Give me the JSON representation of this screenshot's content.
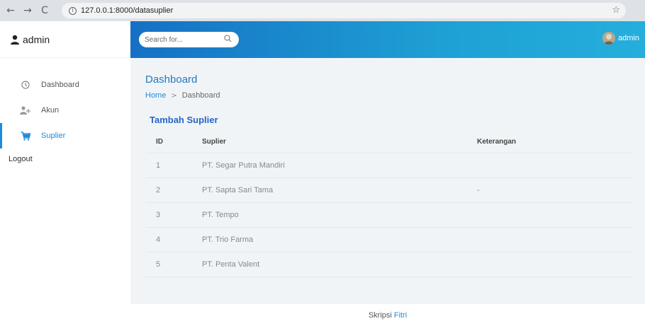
{
  "browser": {
    "url": "127.0.0.1:8000/datasuplier",
    "back_glyph": "←",
    "forward_glyph": "→",
    "reload_glyph": "C",
    "star_glyph": "☆",
    "info_glyph": "i"
  },
  "sidebar": {
    "brand": "admin",
    "items": [
      {
        "label": "Dashboard",
        "icon": "clock-icon"
      },
      {
        "label": "Akun",
        "icon": "user-add-icon"
      },
      {
        "label": "Suplier",
        "icon": "cart-icon",
        "active": true
      }
    ],
    "logout": "Logout"
  },
  "topbar": {
    "search_placeholder": "Search for...",
    "username": "admin"
  },
  "main": {
    "title": "Dashboard",
    "breadcrumb": {
      "home": "Home",
      "separator": ">",
      "current": "Dashboard"
    },
    "add_link": "Tambah Suplier",
    "table": {
      "headers": {
        "id": "ID",
        "name": "Suplier",
        "ket": "Keterangan"
      },
      "rows": [
        {
          "id": "1",
          "name": "PT. Segar Putra Mandiri",
          "ket": ""
        },
        {
          "id": "2",
          "name": "PT. Sapta Sari Tama",
          "ket": "-"
        },
        {
          "id": "3",
          "name": "PT. Tempo",
          "ket": ""
        },
        {
          "id": "4",
          "name": "PT. Trio Farma",
          "ket": ""
        },
        {
          "id": "5",
          "name": "PT. Penta Valent",
          "ket": ""
        }
      ]
    }
  },
  "footer": {
    "text": "Skripsi",
    "name": "Fitri"
  },
  "colors": {
    "accent": "#1d8bdc",
    "topbar_start": "#1670c4",
    "topbar_end": "#25aedc",
    "content_bg": "#f1f4f7"
  }
}
